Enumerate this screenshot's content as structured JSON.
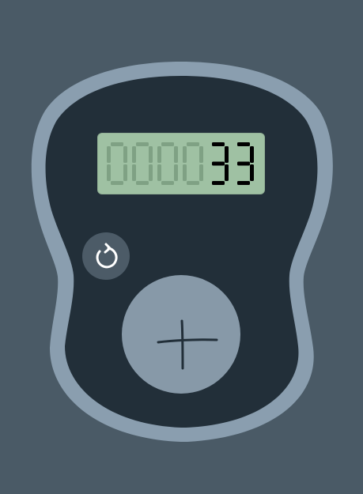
{
  "counter": {
    "value": "33",
    "inactive_digits": "0000",
    "display_digits": 6
  },
  "buttons": {
    "reset_icon": "reset-icon",
    "increment_icon": "plus-icon"
  },
  "colors": {
    "background": "#4a5a66",
    "device_rim": "#8a9eaf",
    "device_face": "#222f39",
    "lcd_background": "#9fc1a3",
    "lcd_inactive_segment": "#7fa184",
    "lcd_active_segment": "#000000",
    "reset_button": "#4c5b67",
    "plus_button": "#8799a8"
  }
}
